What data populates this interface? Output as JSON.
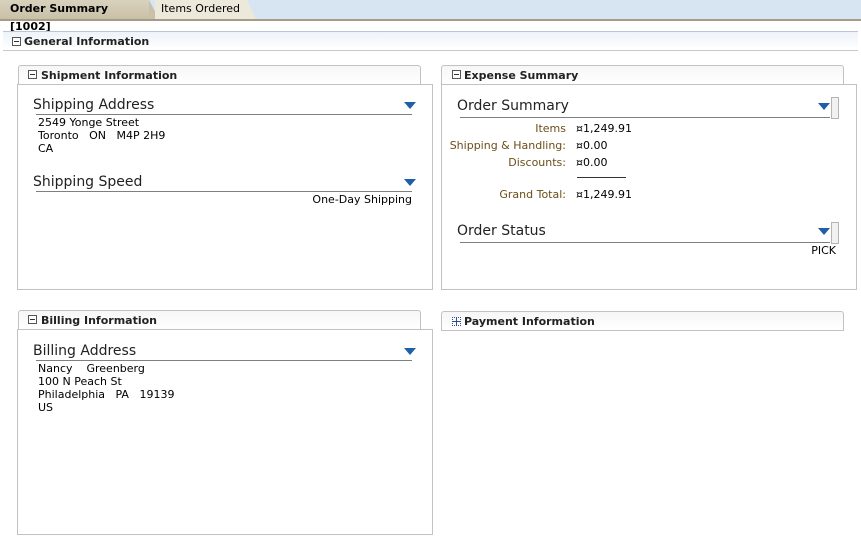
{
  "tabs": [
    {
      "label": "Order Summary [1002]",
      "active": true
    },
    {
      "label": "Items Ordered",
      "active": false
    }
  ],
  "general": {
    "title": "General Information"
  },
  "shipment": {
    "title": "Shipment Information",
    "address_title": "Shipping Address",
    "address_lines": [
      "2549 Yonge Street",
      "Toronto   ON   M4P 2H9",
      "CA"
    ],
    "speed_title": "Shipping Speed",
    "speed_value": "One-Day Shipping"
  },
  "expense": {
    "title": "Expense Summary",
    "order_summary_title": "Order Summary",
    "rows": [
      {
        "label": "Items",
        "value": "¤1,249.91"
      },
      {
        "label": "Shipping & Handling:",
        "value": "¤0.00"
      },
      {
        "label": "Discounts:",
        "value": "¤0.00"
      }
    ],
    "grand_total_label": "Grand Total:",
    "grand_total_value": "¤1,249.91",
    "status_title": "Order Status",
    "status_value": "PICK"
  },
  "billing": {
    "title": "Billing Information",
    "address_title": "Billing Address",
    "address_lines": [
      "Nancy    Greenberg",
      "100 N Peach St",
      "Philadelphia   PA   19139",
      "US"
    ]
  },
  "payment": {
    "title": "Payment Information"
  },
  "colors": {
    "accent_blue": "#1f5fa8",
    "label_brown": "#6b4e18",
    "tab_active": "#c9c0a7"
  }
}
